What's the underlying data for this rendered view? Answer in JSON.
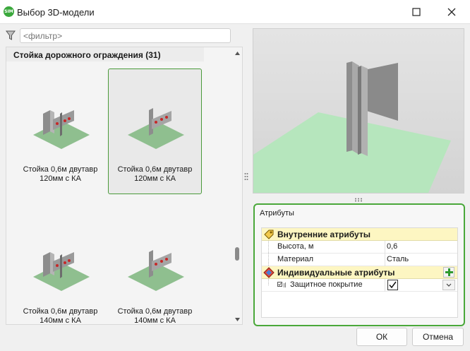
{
  "window": {
    "title": "Выбор 3D-модели",
    "app_icon_text": "SIM",
    "controls": [
      "maximize-icon",
      "close-icon"
    ]
  },
  "filter": {
    "placeholder": "<фильтр>",
    "value": ""
  },
  "models": {
    "group_title": "Стойка дорожного ограждения (31)",
    "items": [
      {
        "line1": "Стойка 0,6м двутавр",
        "line2": "120мм с КА",
        "selected": false
      },
      {
        "line1": "Стойка 0,6м двутавр",
        "line2": "120мм с КА",
        "selected": true
      },
      {
        "line1": "Стойка 0,6м двутавр",
        "line2": "140мм с КА",
        "selected": false
      },
      {
        "line1": "Стойка 0,6м двутавр",
        "line2": "140мм с КА",
        "selected": false
      }
    ]
  },
  "attributes": {
    "title": "Атрибуты",
    "internal_section": "Внутренние атрибуты",
    "internal_rows": [
      {
        "name": "Высота, м",
        "value": "0,6"
      },
      {
        "name": "Материал",
        "value": "Сталь"
      }
    ],
    "individual_section": "Индивидуальные атрибуты",
    "individual_rows": [
      {
        "name": "Защитное покрытие",
        "checked": true
      }
    ]
  },
  "buttons": {
    "ok": "ОК",
    "cancel": "Отмена"
  },
  "colors": {
    "accent_green": "#4aa83a",
    "section_yellow": "#fdf6c2",
    "ground_green": "#8fcf9a"
  }
}
